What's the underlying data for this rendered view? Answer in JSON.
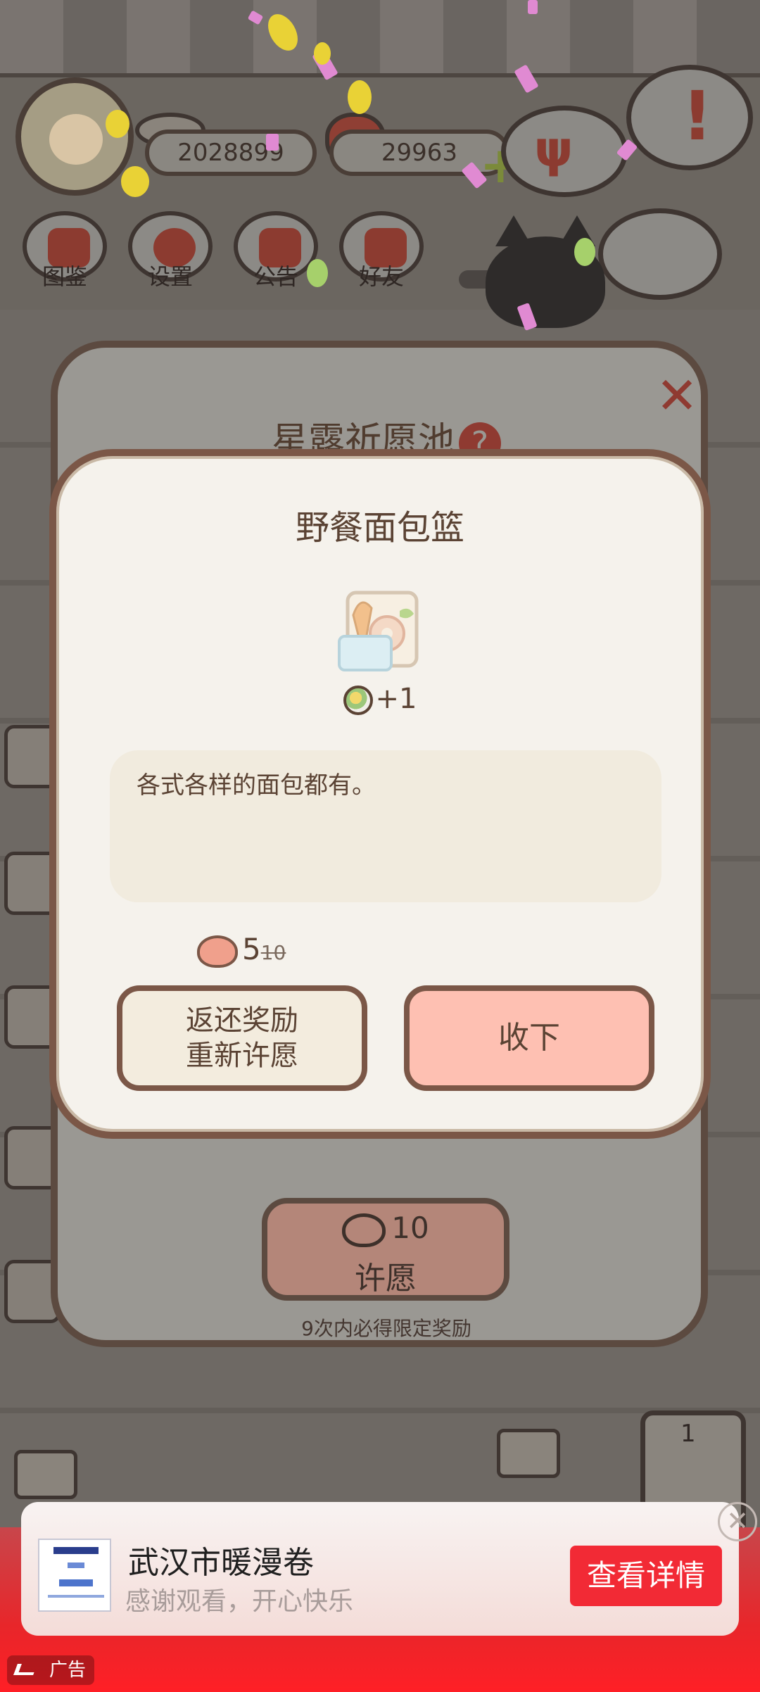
{
  "hud": {
    "currency_fish": "2028899",
    "currency_hearts": "29963",
    "alert_mark": "!",
    "menu": [
      {
        "label": "图鉴",
        "icon": "cat-book-icon"
      },
      {
        "label": "设置",
        "icon": "gear-icon"
      },
      {
        "label": "公告",
        "icon": "gift-icon"
      },
      {
        "label": "好友",
        "icon": "friends-icon"
      }
    ]
  },
  "wish_pool": {
    "title": "星露祈愿池",
    "help": "?",
    "close": "✕",
    "wish_cost": "10",
    "wish_label": "许愿",
    "hint": "9次内必得限定奖励"
  },
  "reward": {
    "title": "野餐面包篮",
    "quantity": "+1",
    "description": "各式各样的面包都有。",
    "cost_now": "5",
    "cost_old": "10",
    "return_line1": "返还奖励",
    "return_line2": "重新许愿",
    "accept": "收下"
  },
  "scene": {
    "elevator_floor": "1"
  },
  "ad": {
    "title": "武汉市暖漫卷",
    "subtitle": "感谢观看，开心快乐",
    "cta": "查看详情",
    "badge": "广告",
    "close": "✕"
  },
  "colors": {
    "accent_pink": "#fec0b2",
    "dialog_border": "#7b5747",
    "ad_red": "#f22a35"
  }
}
